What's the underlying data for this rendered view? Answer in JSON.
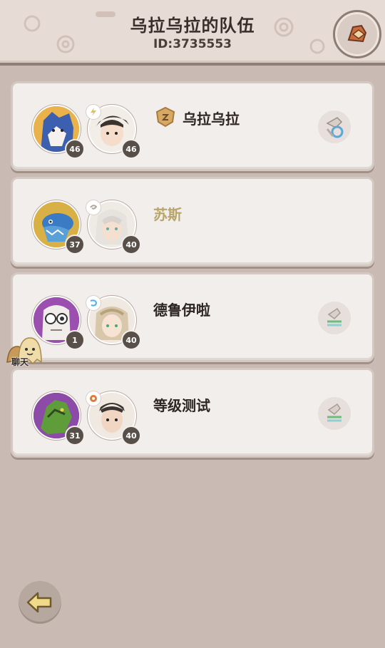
{
  "header": {
    "title": "乌拉乌拉的队伍",
    "team_id": "ID:3735553"
  },
  "members": [
    {
      "name": "乌拉乌拉",
      "name_style": "normal",
      "pet_level": "46",
      "trainer_level": "46",
      "pet_icon": "wolf-pet-avatar",
      "trainer_icon": "trainer-avatar",
      "element_icon": "electric-element-icon",
      "is_leader": true,
      "action_icon": "swap-icon"
    },
    {
      "name": "苏斯",
      "name_style": "gold",
      "pet_level": "37",
      "trainer_level": "40",
      "pet_icon": "dragon-pet-avatar",
      "trainer_icon": "trainer-avatar",
      "element_icon": "wind-element-icon",
      "is_leader": false,
      "action_icon": ""
    },
    {
      "name": "德鲁伊啦",
      "name_style": "normal",
      "pet_level": "1",
      "trainer_level": "40",
      "pet_icon": "ghost-pet-avatar",
      "trainer_icon": "trainer-avatar",
      "element_icon": "water-element-icon",
      "is_leader": false,
      "action_icon": "transfer-icon"
    },
    {
      "name": "等级测试",
      "name_style": "normal",
      "pet_level": "31",
      "trainer_level": "40",
      "pet_icon": "green-dragon-pet-avatar",
      "trainer_icon": "trainer-avatar",
      "element_icon": "fire-element-icon",
      "is_leader": false,
      "action_icon": "transfer-icon"
    }
  ],
  "chat": {
    "label": "聊天"
  },
  "colors": {
    "background": "#c9bab4",
    "card": "#f2eeec",
    "gold_name": "#b7a56a",
    "level_badge": "#585048"
  }
}
